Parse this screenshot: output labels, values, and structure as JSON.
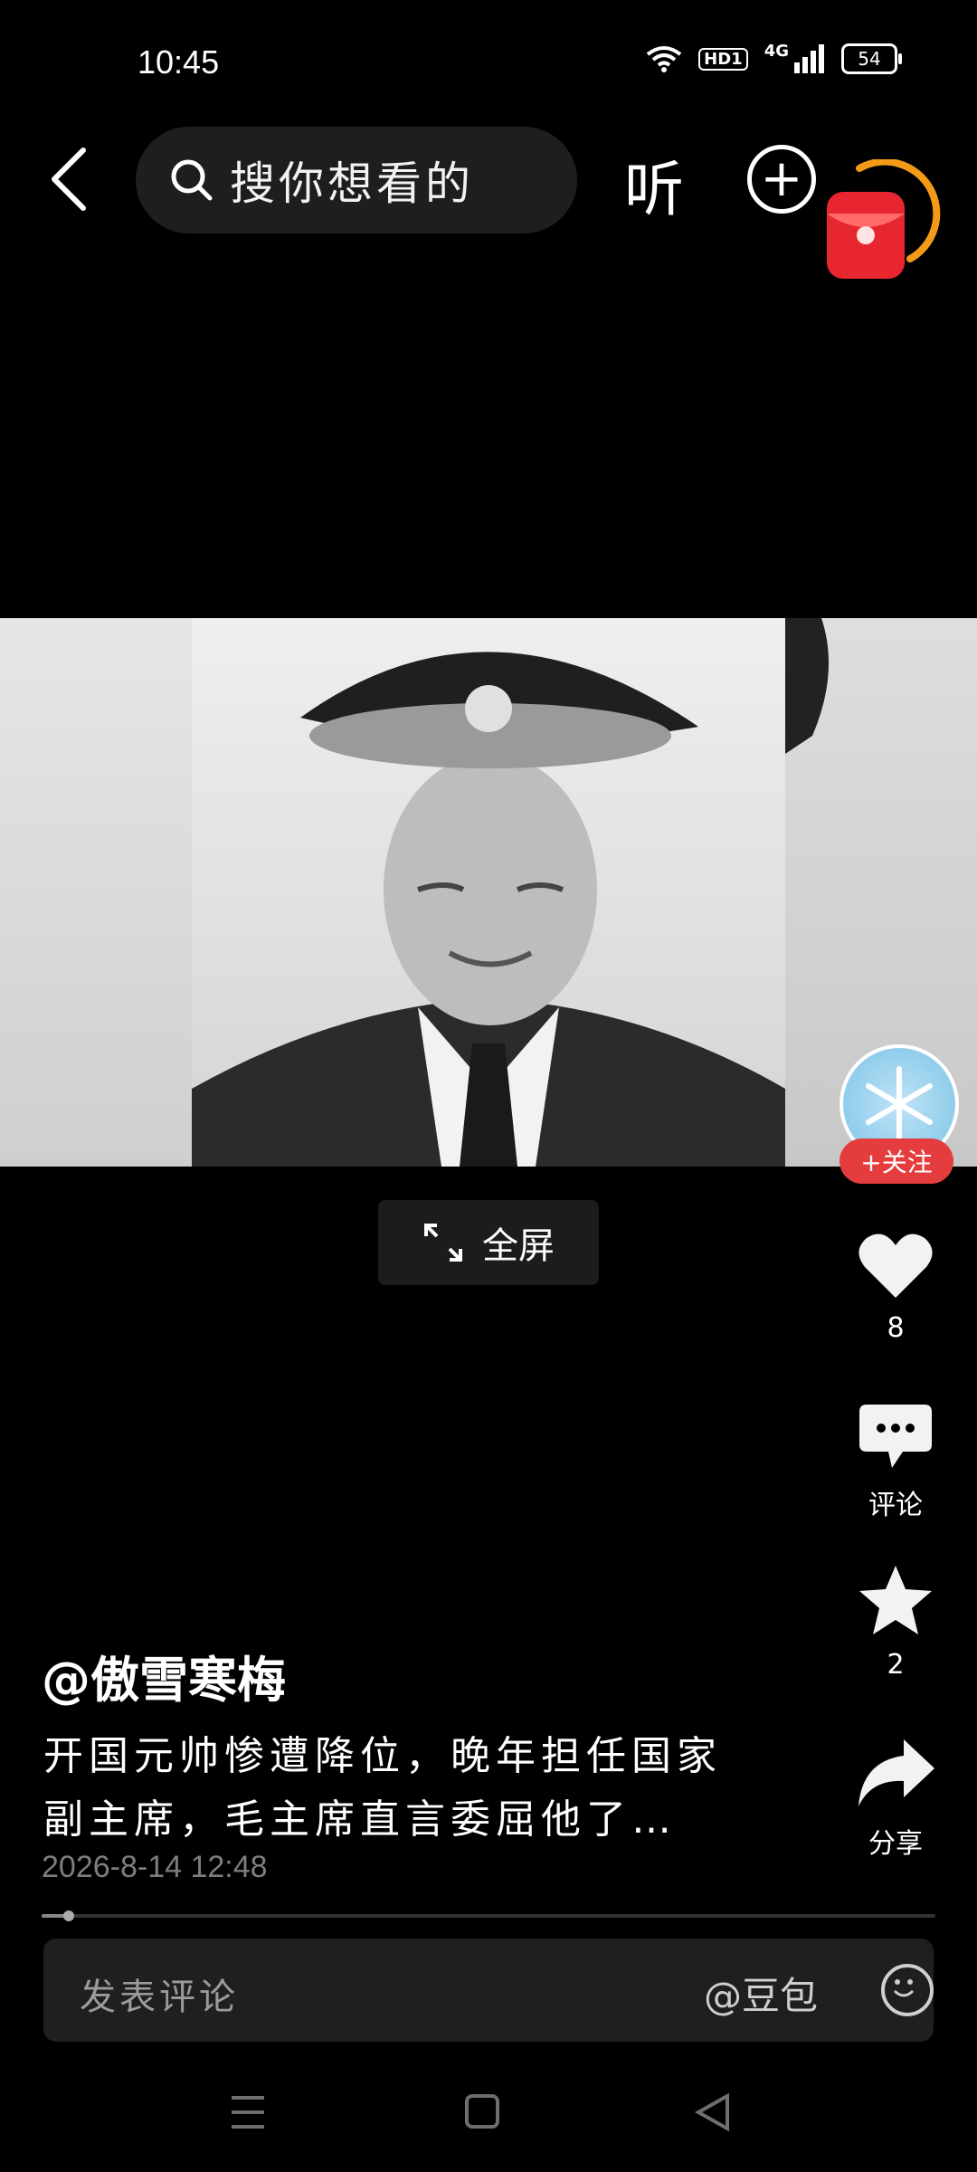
{
  "status_bar": {
    "time": "10:45",
    "hd": "HD1",
    "network": "4G",
    "battery": "54"
  },
  "header": {
    "search_placeholder": "搜你想看的",
    "listen_label": "听"
  },
  "fullscreen": {
    "label": "全屏"
  },
  "author": {
    "follow_label": "+关注"
  },
  "actions": {
    "like_count": "8",
    "comment_label": "评论",
    "favorite_count": "2",
    "share_label": "分享"
  },
  "post": {
    "username": "@傲雪寒梅",
    "caption": "开国元帅惨遭降位，晚年担任国家副主席，毛主席直言委屈他了…",
    "timestamp": "2026-8-14 12:48",
    "progress": 0.03
  },
  "comment_bar": {
    "placeholder": "发表评论",
    "mention_label": "@豆包"
  },
  "colors": {
    "accent_red": "#e53d3d",
    "background": "#000000"
  }
}
